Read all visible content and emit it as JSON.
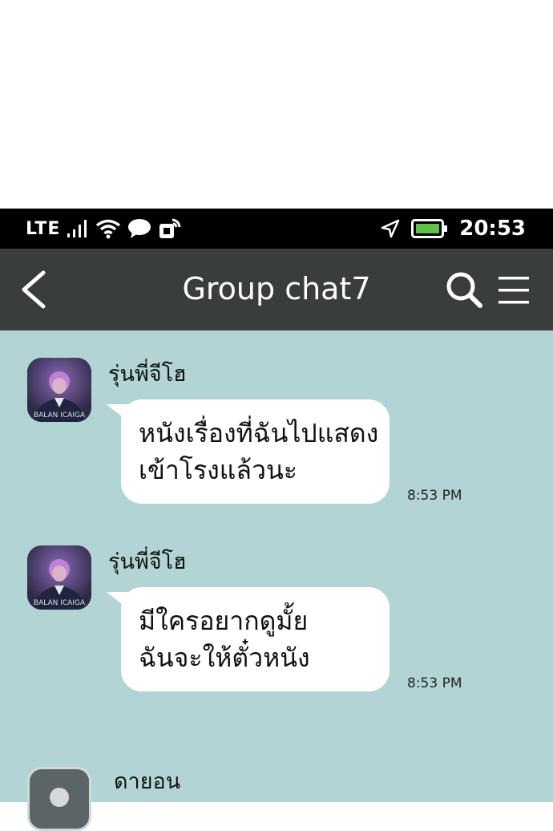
{
  "status_bar": {
    "network": "LTE",
    "time": "20:53",
    "icons": [
      "signal-icon",
      "wifi-icon",
      "chat-notification-icon",
      "app-notification-icon",
      "location-icon",
      "battery-icon"
    ]
  },
  "header": {
    "title": "Group chat7",
    "icons": [
      "back-arrow-icon",
      "search-icon",
      "menu-icon"
    ]
  },
  "colors": {
    "status_bar_bg": "#000000",
    "header_bg": "#393d3e",
    "chat_bg": "#b3d4d5",
    "bubble_bg": "#ffffff",
    "battery_fill": "#5ec24a"
  },
  "messages": [
    {
      "sender": "รุ่นพี่จีโฮ",
      "lines": [
        "หนังเรื่องที่ฉันไปแสดง",
        "เข้าโรงแล้วนะ"
      ],
      "time": "8:53 PM"
    },
    {
      "sender": "รุ่นพี่จีโฮ",
      "lines": [
        "มีใครอยากดูมั้ย",
        "ฉันจะให้ตั๋วหนัง"
      ],
      "time": "8:53 PM"
    },
    {
      "sender": "ดายอน",
      "lines": [],
      "time": ""
    }
  ],
  "avatar_text": "BALAN  ICAIGA"
}
